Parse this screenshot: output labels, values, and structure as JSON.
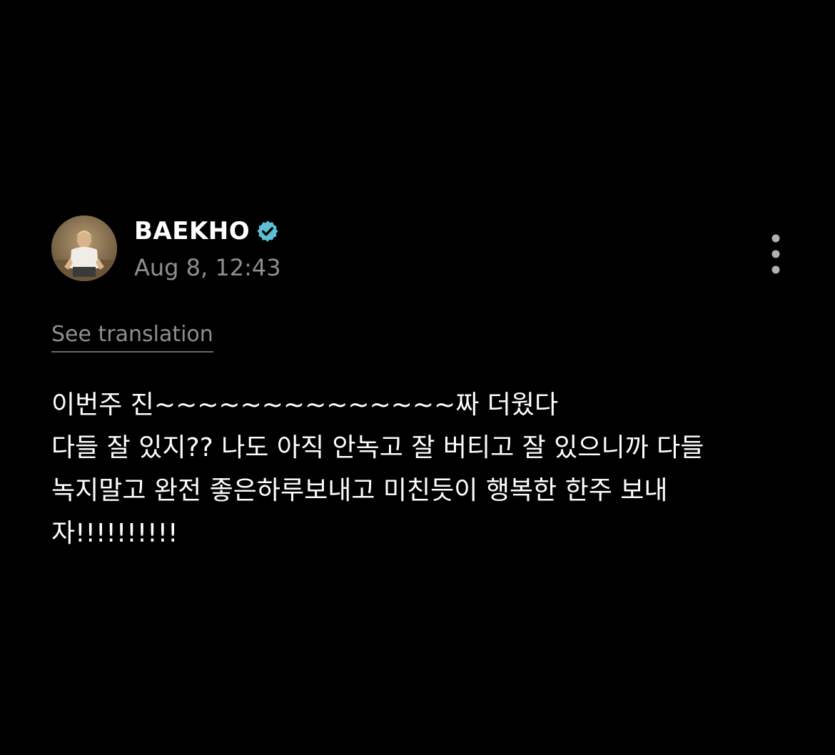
{
  "post": {
    "author": {
      "name": "BAEKHO",
      "verified": true,
      "badge_color": "#5bbfd6",
      "avatar_icon": "profile-photo"
    },
    "timestamp": "Aug 8, 12:43",
    "more_icon": "vertical-ellipsis-icon",
    "see_translation_label": "See translation",
    "body_lines": [
      "이번주 진~~~~~~~~~~~~~~짜 더웠다",
      "다들 잘 있지?? 나도 아직 안녹고 잘 버티고 잘 있으니까 다들",
      "녹지말고 완전 좋은하루보내고 미친듯이 행복한 한주 보내",
      "자!!!!!!!!!!"
    ]
  },
  "colors": {
    "background": "#000000",
    "primary_text": "#ffffff",
    "secondary_text": "#8e8e93",
    "verified_badge": "#5bbfd6"
  }
}
